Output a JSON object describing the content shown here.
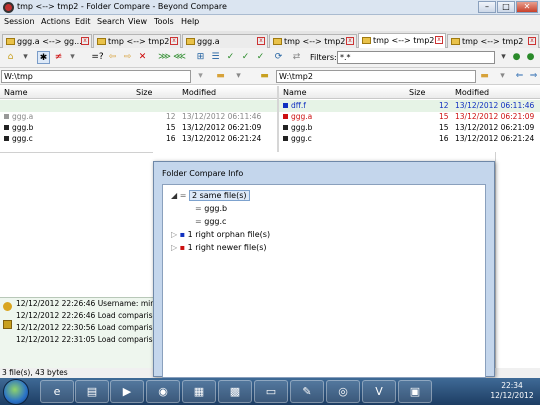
{
  "window": {
    "title": "tmp <--> tmp2 - Folder Compare - Beyond Compare",
    "min": "–",
    "max": "□",
    "close": "✕"
  },
  "menu": [
    "Session",
    "Actions",
    "Edit",
    "Search",
    "View",
    "Tools",
    "Help"
  ],
  "tabs": [
    {
      "label": "ggg.a <--> gg..."
    },
    {
      "label": "tmp <--> tmp2"
    },
    {
      "label": "ggg.a"
    },
    {
      "label": "tmp <--> tmp2"
    },
    {
      "label": "tmp <--> tmp2"
    },
    {
      "label": "tmp <--> tmp2"
    }
  ],
  "toolbar": {
    "filters_label": "Filters:",
    "filters_value": "*.*"
  },
  "left": {
    "path": "W:\\tmp",
    "cols": {
      "name": "Name",
      "size": "Size",
      "modified": "Modified"
    },
    "rows": [
      {
        "name": "ggg.a",
        "size": "12",
        "modified": "13/12/2012 06:11:46"
      },
      {
        "name": "ggg.b",
        "size": "15",
        "modified": "13/12/2012 06:21:09"
      },
      {
        "name": "ggg.c",
        "size": "16",
        "modified": "13/12/2012 06:21:24"
      }
    ]
  },
  "right": {
    "path": "W:\\tmp2",
    "cols": {
      "name": "Name",
      "size": "Size",
      "modified": "Modified"
    },
    "rows": [
      {
        "name": "dff.f",
        "size": "12",
        "modified": "13/12/2012 06:11:46"
      },
      {
        "name": "ggg.a",
        "size": "15",
        "modified": "13/12/2012 06:21:09"
      },
      {
        "name": "ggg.b",
        "size": "15",
        "modified": "13/12/2012 06:21:09"
      },
      {
        "name": "ggg.c",
        "size": "16",
        "modified": "13/12/2012 06:21:24"
      }
    ]
  },
  "log": [
    {
      "time": "12/12/2012 22:26:46",
      "msg": "Username: mini-"
    },
    {
      "time": "12/12/2012 22:26:46",
      "msg": "Load comparison"
    },
    {
      "time": "12/12/2012 22:30:56",
      "msg": "Load comparison"
    },
    {
      "time": "12/12/2012 22:31:05",
      "msg": "Load comparison"
    }
  ],
  "status": "3 file(s), 43 bytes",
  "dialog": {
    "title": "Folder Compare Info",
    "tree": {
      "same": "2 same file(s)",
      "same_children": [
        "ggg.b",
        "ggg.c"
      ],
      "orphan": "1 right orphan file(s)",
      "newer": "1 right newer file(s)"
    }
  },
  "clock": {
    "time": "22:34",
    "date": "12/12/2012"
  },
  "colors": {
    "orphan": "#1030c0",
    "newer": "#cc1010",
    "same_gray": "#888888"
  }
}
